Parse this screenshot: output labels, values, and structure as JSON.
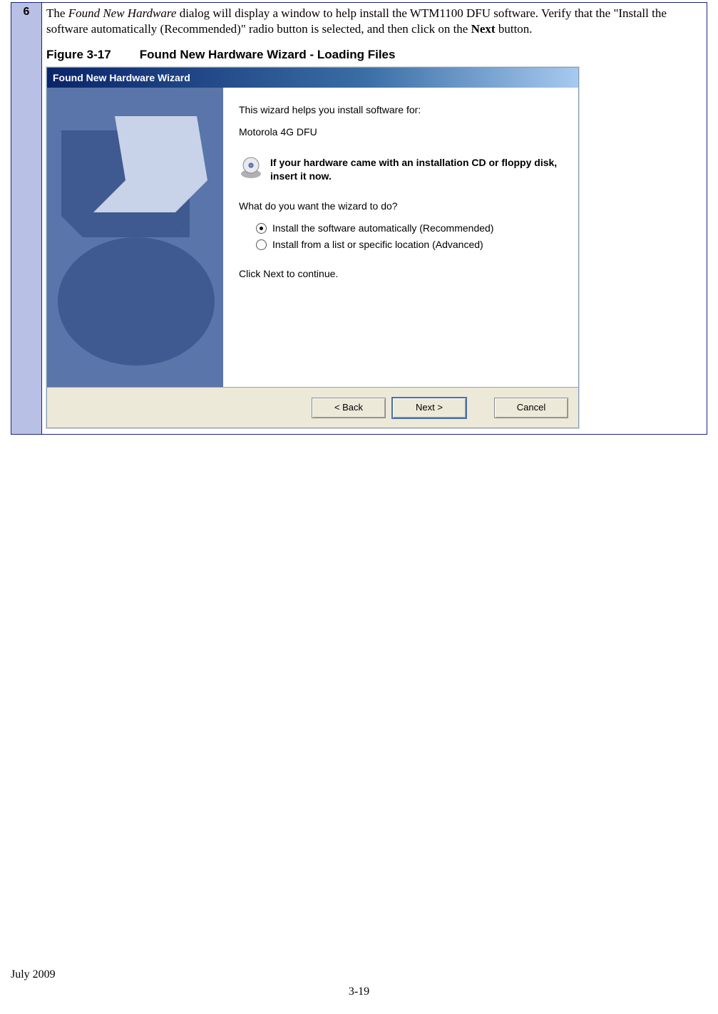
{
  "step": {
    "number": "6",
    "text_part1": "The ",
    "dialog_name": "Found New Hardware",
    "text_part2": " dialog will display a window to help install the WTM1100 DFU software.  Verify that the \"Install the software automatically (Recommended)\" radio button is selected, and then click on the ",
    "next_label": "Next",
    "text_part3": " button."
  },
  "figure": {
    "label": "Figure 3-17",
    "title": "Found New Hardware Wizard - Loading Files"
  },
  "wizard": {
    "title": "Found New Hardware Wizard",
    "intro": "This wizard helps you install software for:",
    "device": "Motorola 4G DFU",
    "cd_text": "If your hardware came with an installation CD or floppy disk, insert it now.",
    "question": "What do you want the wizard to do?",
    "option1": "Install the software automatically (Recommended)",
    "option2": "Install from a list or specific location (Advanced)",
    "continue": "Click Next to continue.",
    "btn_back": "< Back",
    "btn_next": "Next >",
    "btn_cancel": "Cancel"
  },
  "footer": {
    "date": "July 2009",
    "page": "3-19"
  }
}
